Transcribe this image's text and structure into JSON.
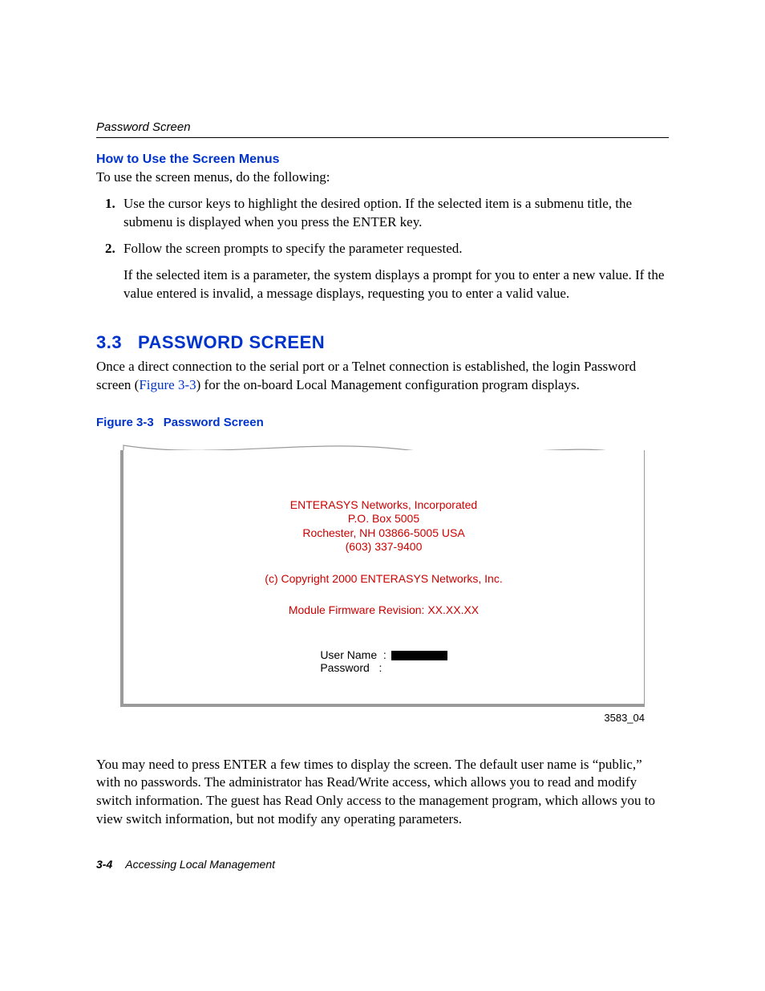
{
  "header": {
    "running": "Password Screen"
  },
  "subsection": {
    "title": "How to Use the Screen Menus",
    "intro": "To use the screen menus, do the following:"
  },
  "steps": {
    "1": "Use the cursor keys to highlight the desired option. If the selected item is a submenu title, the submenu is displayed when you press the ENTER key.",
    "2": "Follow the screen prompts to specify the parameter requested.",
    "2b": "If the selected item is a parameter, the system displays a prompt for you to enter a new value. If the value entered is invalid, a message displays, requesting you to enter a valid value."
  },
  "section": {
    "number": "3.3",
    "title": "PASSWORD SCREEN",
    "p1a": "Once a direct connection to the serial port or a Telnet connection is established, the login Password screen (",
    "p1_link": "Figure 3-3",
    "p1b": ") for the on-board Local Management configuration program displays."
  },
  "figure": {
    "label": "Figure 3-3",
    "name": "Password Screen",
    "id": "3583_04"
  },
  "screen": {
    "company": "ENTERASYS Networks, Incorporated",
    "pobox": "P.O. Box 5005",
    "address": "Rochester, NH 03866-5005 USA",
    "phone": "(603) 337-9400",
    "copyright": "(c) Copyright 2000 ENTERASYS Networks, Inc.",
    "firmware": "Module Firmware Revision: XX.XX.XX",
    "username_label": "User Name  :",
    "password_label": "Password   :"
  },
  "after_figure": "You may need to press ENTER a few times to display the screen. The default user name is “public,” with no passwords. The administrator has Read/Write access, which allows you to read and modify switch information. The guest has Read Only access to the management program, which allows you to view switch information, but not modify any operating parameters.",
  "footer": {
    "page": "3-4",
    "chapter": "Accessing Local Management"
  }
}
